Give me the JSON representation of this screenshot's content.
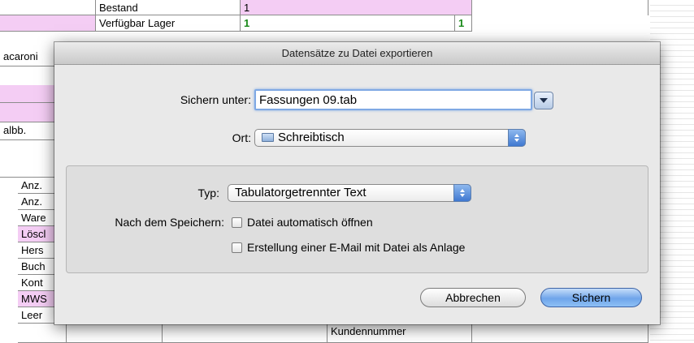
{
  "spreadsheet": {
    "top_label_1": "Bestand",
    "top_value_1": "1",
    "top_label_2": "Verfügbar Lager",
    "top_value_2": "1",
    "top_value_2b": "1",
    "left_partial_1": "acaroni",
    "left_partial_2": "albb.",
    "row_labels": [
      "Anz.",
      "Anz.",
      "Ware",
      "Löscl",
      "Hers",
      "Buch",
      "Kont",
      "MWS",
      "Leer"
    ],
    "bottom_field": "Kundennummer"
  },
  "dialog": {
    "title": "Datensätze zu Datei exportieren",
    "save_as_label": "Sichern unter:",
    "filename_value": "Fassungen 09.tab",
    "location_label": "Ort:",
    "location_value": "Schreibtisch",
    "type_label": "Typ:",
    "type_value": "Tabulatorgetrennter Text",
    "after_save_label": "Nach dem Speichern:",
    "checkbox_open_label": "Datei automatisch öffnen",
    "checkbox_email_label": "Erstellung einer E-Mail mit Datei als Anlage",
    "cancel_label": "Abbrechen",
    "save_label": "Sichern"
  }
}
